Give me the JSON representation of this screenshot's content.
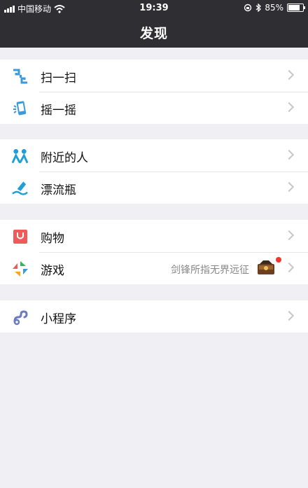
{
  "status": {
    "carrier": "中国移动",
    "time": "19:39",
    "battery": "85%"
  },
  "header": {
    "title": "发现"
  },
  "groups": [
    {
      "items": [
        {
          "label": "扫一扫",
          "icon": "scan-icon"
        },
        {
          "label": "摇一摇",
          "icon": "shake-icon"
        }
      ]
    },
    {
      "items": [
        {
          "label": "附近的人",
          "icon": "people-nearby-icon"
        },
        {
          "label": "漂流瓶",
          "icon": "drift-bottle-icon"
        }
      ]
    },
    {
      "items": [
        {
          "label": "购物",
          "icon": "shopping-icon"
        },
        {
          "label": "游戏",
          "icon": "games-icon",
          "extra": "剑锋所指无界远征"
        }
      ]
    },
    {
      "items": [
        {
          "label": "小程序",
          "icon": "mini-programs-icon"
        }
      ]
    }
  ],
  "colors": {
    "nav_bg": "#2e2e33",
    "page_bg": "#efeff4",
    "badge": "#f43530"
  }
}
